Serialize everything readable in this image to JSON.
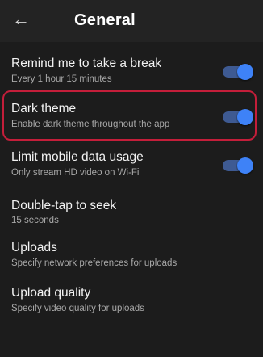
{
  "header": {
    "title": "General",
    "back_icon": "back-arrow-icon"
  },
  "settings": [
    {
      "title": "Remind me to take a break",
      "subtitle": "Every 1 hour 15 minutes",
      "toggle": true
    },
    {
      "title": "Dark theme",
      "subtitle": "Enable dark theme throughout the app",
      "toggle": true,
      "highlighted": true
    },
    {
      "title": "Limit mobile data usage",
      "subtitle": "Only stream HD video on Wi-Fi",
      "toggle": true
    },
    {
      "title": "Double-tap to seek",
      "subtitle": "15 seconds"
    },
    {
      "title": "Uploads",
      "subtitle": "Specify network preferences for uploads"
    },
    {
      "title": "Upload quality",
      "subtitle": "Specify video quality for uploads"
    }
  ],
  "colors": {
    "background": "#1c1c1c",
    "toggle_on": "#3e82f7",
    "highlight": "#c41e3a"
  }
}
